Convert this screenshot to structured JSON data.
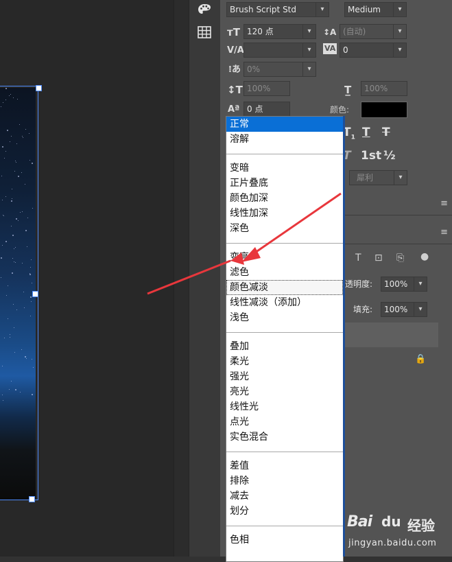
{
  "character": {
    "font_family": "Brush Script Std",
    "font_style": "Medium",
    "font_size": "120 点",
    "leading": "(自动)",
    "kerning": "",
    "tracking": "0",
    "tsume": "0%",
    "vertical_scale": "100%",
    "horizontal_scale": "100%",
    "baseline_shift": "0 点",
    "color_label": "颜色:",
    "antialias": "犀利",
    "ordinal_label": "1st",
    "fraction_label": "½"
  },
  "layers": {
    "opacity_label": "透明度:",
    "opacity_value": "100%",
    "fill_label": "填充:",
    "fill_value": "100%"
  },
  "blend_menu": {
    "groups": [
      [
        "正常",
        "溶解"
      ],
      [
        "变暗",
        "正片叠底",
        "颜色加深",
        "线性加深",
        "深色"
      ],
      [
        "变亮",
        "滤色",
        "颜色减淡",
        "线性减淡（添加）",
        "浅色"
      ],
      [
        "叠加",
        "柔光",
        "强光",
        "亮光",
        "线性光",
        "点光",
        "实色混合"
      ],
      [
        "差值",
        "排除",
        "减去",
        "划分"
      ],
      [
        "色相"
      ]
    ],
    "selected": "正常",
    "hovered": "颜色减淡"
  },
  "watermark": {
    "logo": "Bai",
    "paw_text": "du",
    "text": "经验",
    "url": "jingyan.baidu.com"
  },
  "colors": {
    "panel_bg": "#535353",
    "selection_blue": "#0a6fd6",
    "arrow_red": "#e8373c",
    "text_color": "#000000"
  }
}
